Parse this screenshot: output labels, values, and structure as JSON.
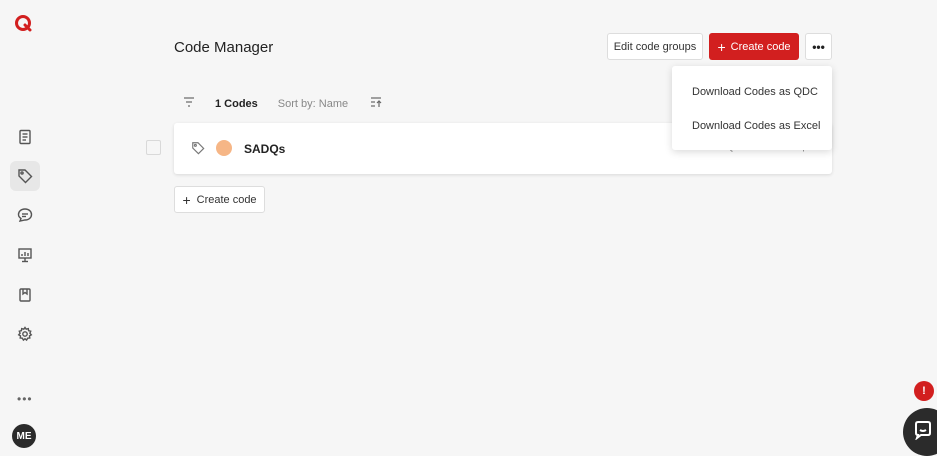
{
  "app": {
    "brand_color": "#d21f1f",
    "logo_icon": "app-logo-icon"
  },
  "sidebar": {
    "items": [
      {
        "name": "documents",
        "icon": "document-icon",
        "active": false
      },
      {
        "name": "codes",
        "icon": "tag-icon",
        "active": true
      },
      {
        "name": "memos",
        "icon": "comment-icon",
        "active": false
      },
      {
        "name": "charts",
        "icon": "presentation-chart-icon",
        "active": false
      },
      {
        "name": "bookmarks",
        "icon": "bookmark-icon",
        "active": false
      },
      {
        "name": "settings",
        "icon": "gear-icon",
        "active": false
      }
    ],
    "more_label": "•••",
    "avatar_initials": "ME"
  },
  "header": {
    "title": "Code Manager",
    "edit_groups_label": "Edit code groups",
    "create_code_label": "Create code",
    "more_label": "•••"
  },
  "toolbar": {
    "count_label": "1 Codes",
    "sort_label": "Sort by: Name"
  },
  "codes": [
    {
      "name": "SADQs",
      "color": "#f6b686",
      "secondary_text": "FREQUENTLY ASKED  |"
    }
  ],
  "bottom": {
    "create_code_label": "Create code"
  },
  "dropdown": {
    "items": [
      "Download Codes as QDC",
      "Download Codes as Excel"
    ]
  },
  "notifications": {
    "badge_text": "!"
  }
}
